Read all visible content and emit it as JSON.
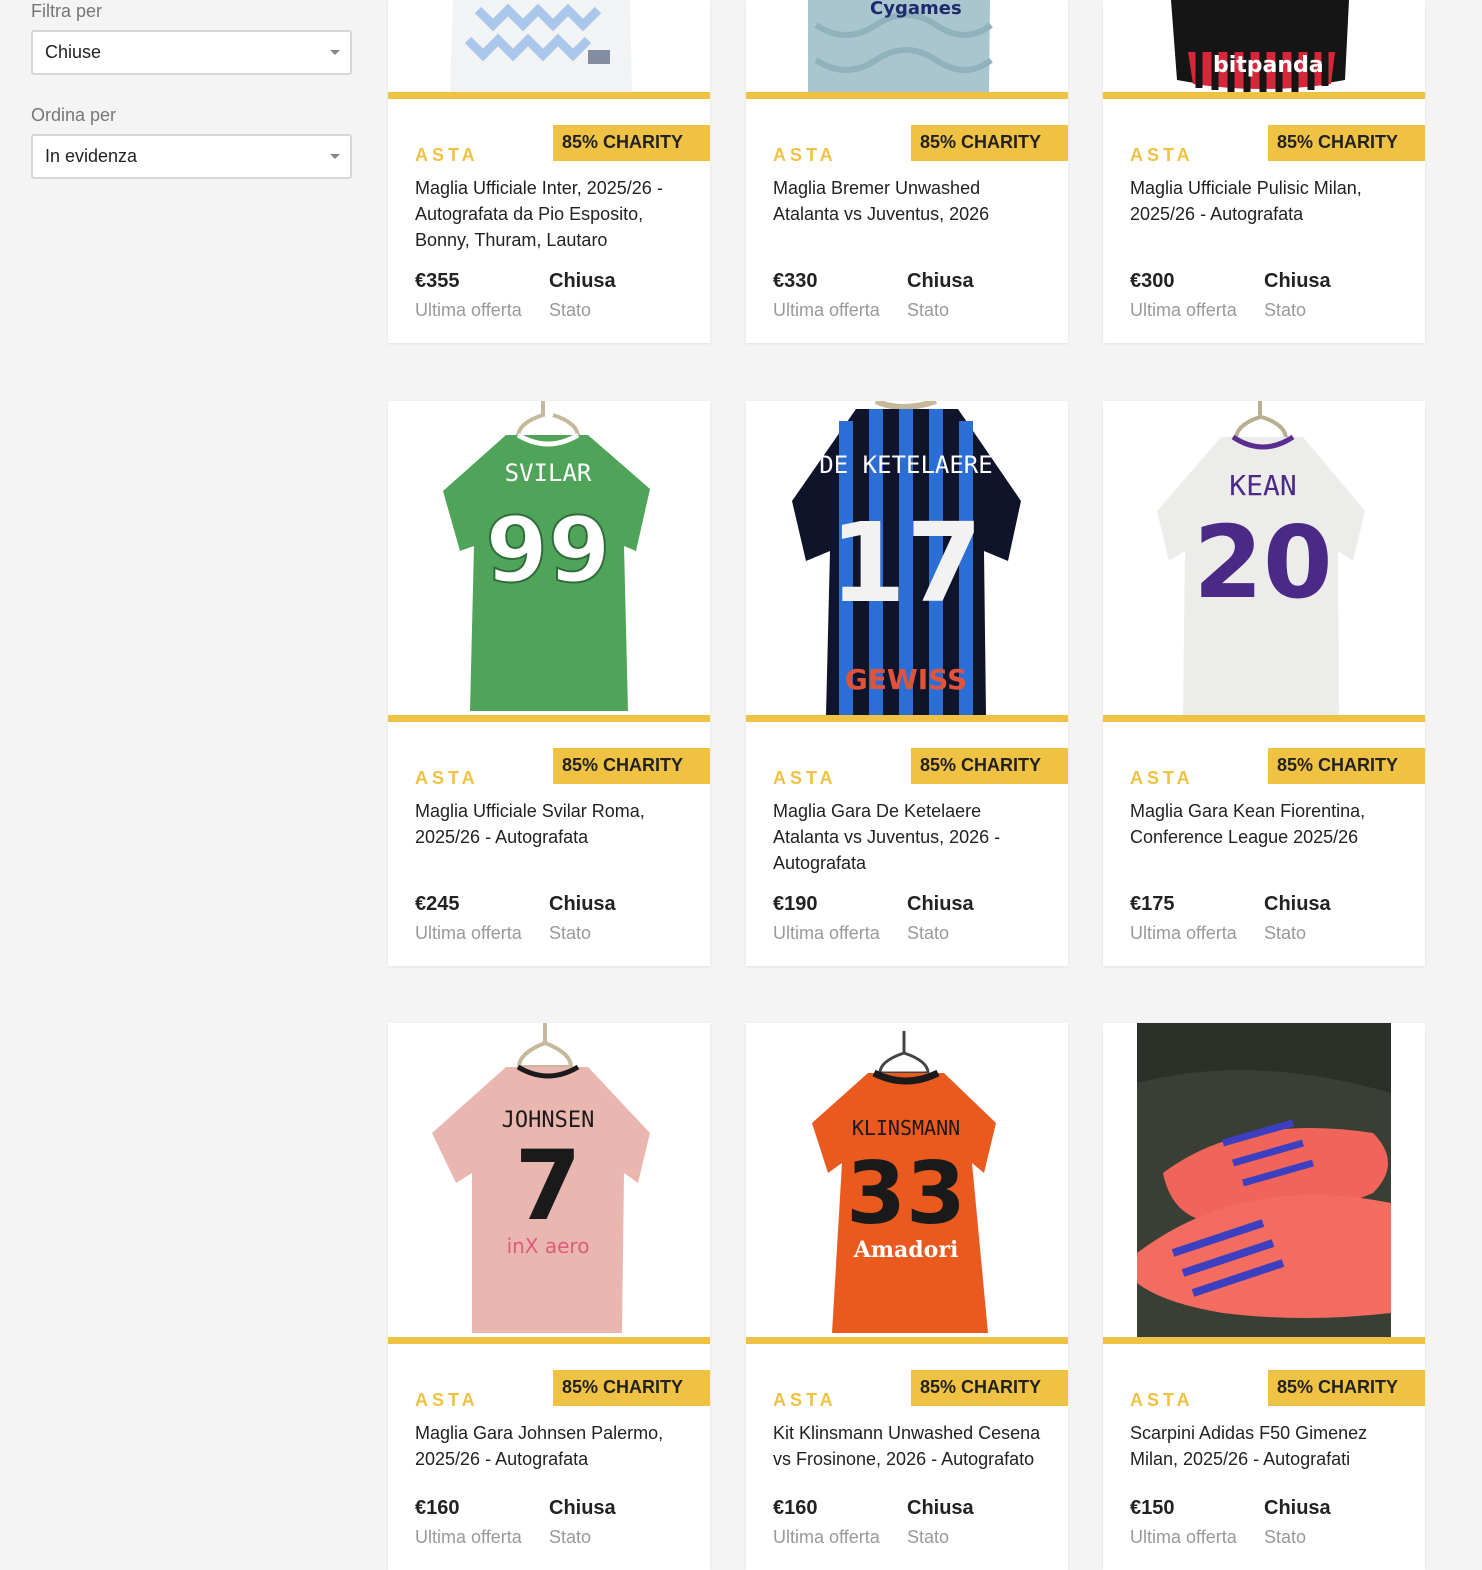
{
  "sidebar": {
    "filter_label": "Filtra per",
    "filter_value": "Chiuse",
    "sort_label": "Ordina per",
    "sort_value": "In evidenza"
  },
  "colors": {
    "accent": "#f0c243",
    "background": "#f4f4f4"
  },
  "cards": [
    {
      "type": "ASTA",
      "badge": "85% CHARITY",
      "title": "Maglia Ufficiale Inter, 2025/26 - Autografata da Pio Esposito, Bonny, Thuram, Lautaro",
      "price": "€355",
      "price_label": "Ultima offerta",
      "status": "Chiusa",
      "status_label": "Stato",
      "icon": "white-jersey-image"
    },
    {
      "type": "ASTA",
      "badge": "85% CHARITY",
      "title": "Maglia Bremer Unwashed Atalanta vs Juventus, 2026",
      "price": "€330",
      "price_label": "Ultima offerta",
      "status": "Chiusa",
      "status_label": "Stato",
      "icon": "light-blue-jersey-image",
      "sponsor": "Cygames"
    },
    {
      "type": "ASTA",
      "badge": "85% CHARITY",
      "title": "Maglia Ufficiale Pulisic Milan, 2025/26 - Autografata",
      "price": "€300",
      "price_label": "Ultima offerta",
      "status": "Chiusa",
      "status_label": "Stato",
      "icon": "milan-jersey-image",
      "sponsor": "bitpanda"
    },
    {
      "type": "ASTA",
      "badge": "85% CHARITY",
      "title": "Maglia Ufficiale Svilar Roma, 2025/26 - Autografata",
      "price": "€245",
      "price_label": "Ultima offerta",
      "status": "Chiusa",
      "status_label": "Stato",
      "icon": "green-jersey-image",
      "jersey_name": "SVILAR",
      "jersey_number": "99"
    },
    {
      "type": "ASTA",
      "badge": "85% CHARITY",
      "title": "Maglia Gara De Ketelaere Atalanta vs Juventus, 2026 - Autografata",
      "price": "€190",
      "price_label": "Ultima offerta",
      "status": "Chiusa",
      "status_label": "Stato",
      "icon": "atalanta-jersey-image",
      "jersey_name": "DE KETELAERE",
      "jersey_number": "17",
      "sponsor": "GEWISS"
    },
    {
      "type": "ASTA",
      "badge": "85% CHARITY",
      "title": "Maglia Gara Kean Fiorentina, Conference League 2025/26",
      "price": "€175",
      "price_label": "Ultima offerta",
      "status": "Chiusa",
      "status_label": "Stato",
      "icon": "fiorentina-jersey-image",
      "jersey_name": "KEAN",
      "jersey_number": "20"
    },
    {
      "type": "ASTA",
      "badge": "85% CHARITY",
      "title": "Maglia Gara Johnsen Palermo, 2025/26 - Autografata",
      "price": "€160",
      "price_label": "Ultima offerta",
      "status": "Chiusa",
      "status_label": "Stato",
      "icon": "pink-jersey-image",
      "jersey_name": "JOHNSEN",
      "jersey_number": "7",
      "sponsor": "inX aero"
    },
    {
      "type": "ASTA",
      "badge": "85% CHARITY",
      "title": "Kit Klinsmann Unwashed Cesena vs Frosinone, 2026 - Autografato",
      "price": "€160",
      "price_label": "Ultima offerta",
      "status": "Chiusa",
      "status_label": "Stato",
      "icon": "orange-jersey-image",
      "jersey_name": "KLINSMANN",
      "jersey_number": "33",
      "sponsor": "Amadori"
    },
    {
      "type": "ASTA",
      "badge": "85% CHARITY",
      "title": "Scarpini Adidas F50 Gimenez Milan, 2025/26 - Autografati",
      "price": "€150",
      "price_label": "Ultima offerta",
      "status": "Chiusa",
      "status_label": "Stato",
      "icon": "boots-image"
    }
  ]
}
